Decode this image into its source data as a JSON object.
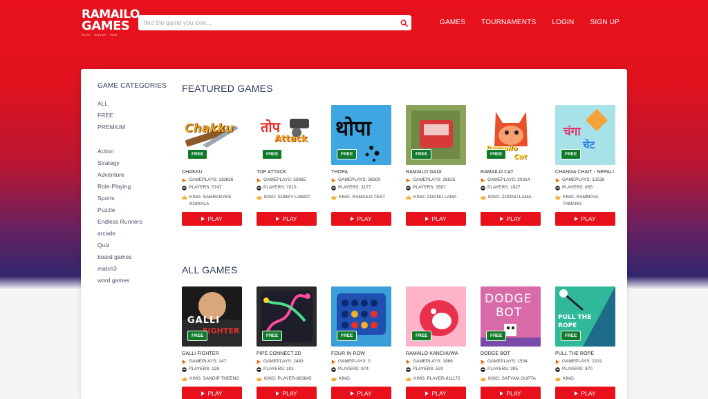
{
  "header": {
    "logo_line1": "RAMAILO",
    "logo_line2": "GAMES",
    "logo_tagline": "PLAY · ENJOY · WIN",
    "search_placeholder": "find the game you love...",
    "nav": [
      "GAMES",
      "TOURNAMENTS",
      "LOGIN",
      "SIGN UP"
    ]
  },
  "sidebar": {
    "title": "GAME CATEGORIES",
    "pricing": [
      "ALL",
      "FREE",
      "PREMIUM"
    ],
    "genres": [
      "Action",
      "Strategy",
      "Adventure",
      "Role-Playing",
      "Sports",
      "Puzzle",
      "Endless Runners",
      "arcade",
      "Quiz",
      "board games",
      "match3",
      "word games"
    ]
  },
  "featured": {
    "title": "FEATURED GAMES",
    "games": [
      {
        "name": "CHAKKU",
        "gameplays": "GAMEPLAYS: 119826",
        "players": "PLAYERS: 5747",
        "king": "KING: SAMRAGYEE KOIRALA",
        "free": "FREE",
        "thumb_text": "Chakku",
        "bg": "#ffffff"
      },
      {
        "name": "TOP ATTACK",
        "gameplays": "GAMEPLAYS: 53065",
        "players": "PLAYERS: 7010",
        "king": "KING: SONEY LAWOT",
        "free": "FREE",
        "thumb_text": "तोप",
        "thumb_text2": "Attack",
        "bg": "#ffffff"
      },
      {
        "name": "THOPA",
        "gameplays": "GAMEPLAYS: 38300",
        "players": "PLAYERS: 3177",
        "king": "KING: RAMAILO TEST",
        "free": "FREE",
        "thumb_text": "थोपा",
        "bg": "#3ea6e0"
      },
      {
        "name": "RAMAILO GADI",
        "gameplays": "GAMEPLAYS: 28625",
        "players": "PLAYERS: 3587",
        "king": "KING: ZOONU LAMA",
        "free": "FREE",
        "bg": "#8aa35a"
      },
      {
        "name": "RAMAILO CAT",
        "gameplays": "GAMEPLAYS: 20314",
        "players": "PLAYERS: 1927",
        "king": "KING: ZOONU LAMA",
        "free": "FREE",
        "thumb_text": "Ramailo",
        "thumb_text2": "Cat",
        "bg": "#ffffff"
      },
      {
        "name": "CHANGA CHAIT - NEPALI",
        "gameplays": "GAMEPLAYS: 12536",
        "players": "PLAYERS: 855",
        "king": "KING: RAMMAYA TAMANG",
        "free": "FREE",
        "thumb_text": "चंगा",
        "thumb_text2": "चेट",
        "bg": "#a6e2e8"
      }
    ]
  },
  "all_games": {
    "title": "ALL GAMES",
    "games": [
      {
        "name": "GALLI FIGHTER",
        "gameplays": "GAMEPLAYS: 147",
        "players": "PLAYERS: 128",
        "king": "KING: SANDIP THEENG",
        "free": "FREE",
        "thumb_text": "GALLI",
        "thumb_text2": "FIGHTER",
        "bg": "#1a1a1a"
      },
      {
        "name": "PIPE CONNECT 2D",
        "gameplays": "GAMEPLAYS: 2483",
        "players": "PLAYERS: 101",
        "king": "KING: PLAYER-863845",
        "free": "FREE",
        "bg": "#2a2a2a"
      },
      {
        "name": "FOUR IN ROW",
        "gameplays": "GAMEPLAYS: 0",
        "players": "PLAYERS: 974",
        "king": "KING:",
        "free": "FREE",
        "bg": "#3a9ed8"
      },
      {
        "name": "RAMAILO KANCHUWA",
        "gameplays": "GAMEPLAYS: 1966",
        "players": "PLAYERS: 520",
        "king": "KING: PLAYER-811172",
        "free": "FREE",
        "bg": "#ffb3c8"
      },
      {
        "name": "DODGE BOT",
        "gameplays": "GAMEPLAYS: 1534",
        "players": "PLAYERS: 395",
        "king": "KING: SATYAM GUPTA",
        "free": "FREE",
        "thumb_text": "DODGE",
        "thumb_text2": "BOT",
        "bg": "#d86aa8"
      },
      {
        "name": "PULL THE ROPE",
        "gameplays": "GAMEPLAYS: 2231",
        "players": "PLAYERS: 870",
        "king": "KING:",
        "free": "FREE",
        "thumb_text": "PULL THE",
        "thumb_text2": "ROPE",
        "bg": "#2fb89a"
      }
    ]
  },
  "play_label": "PLAY",
  "colors": {
    "brand_red": "#e8111b",
    "free_green": "#0f7a2a",
    "heading": "#2b3a5a"
  }
}
